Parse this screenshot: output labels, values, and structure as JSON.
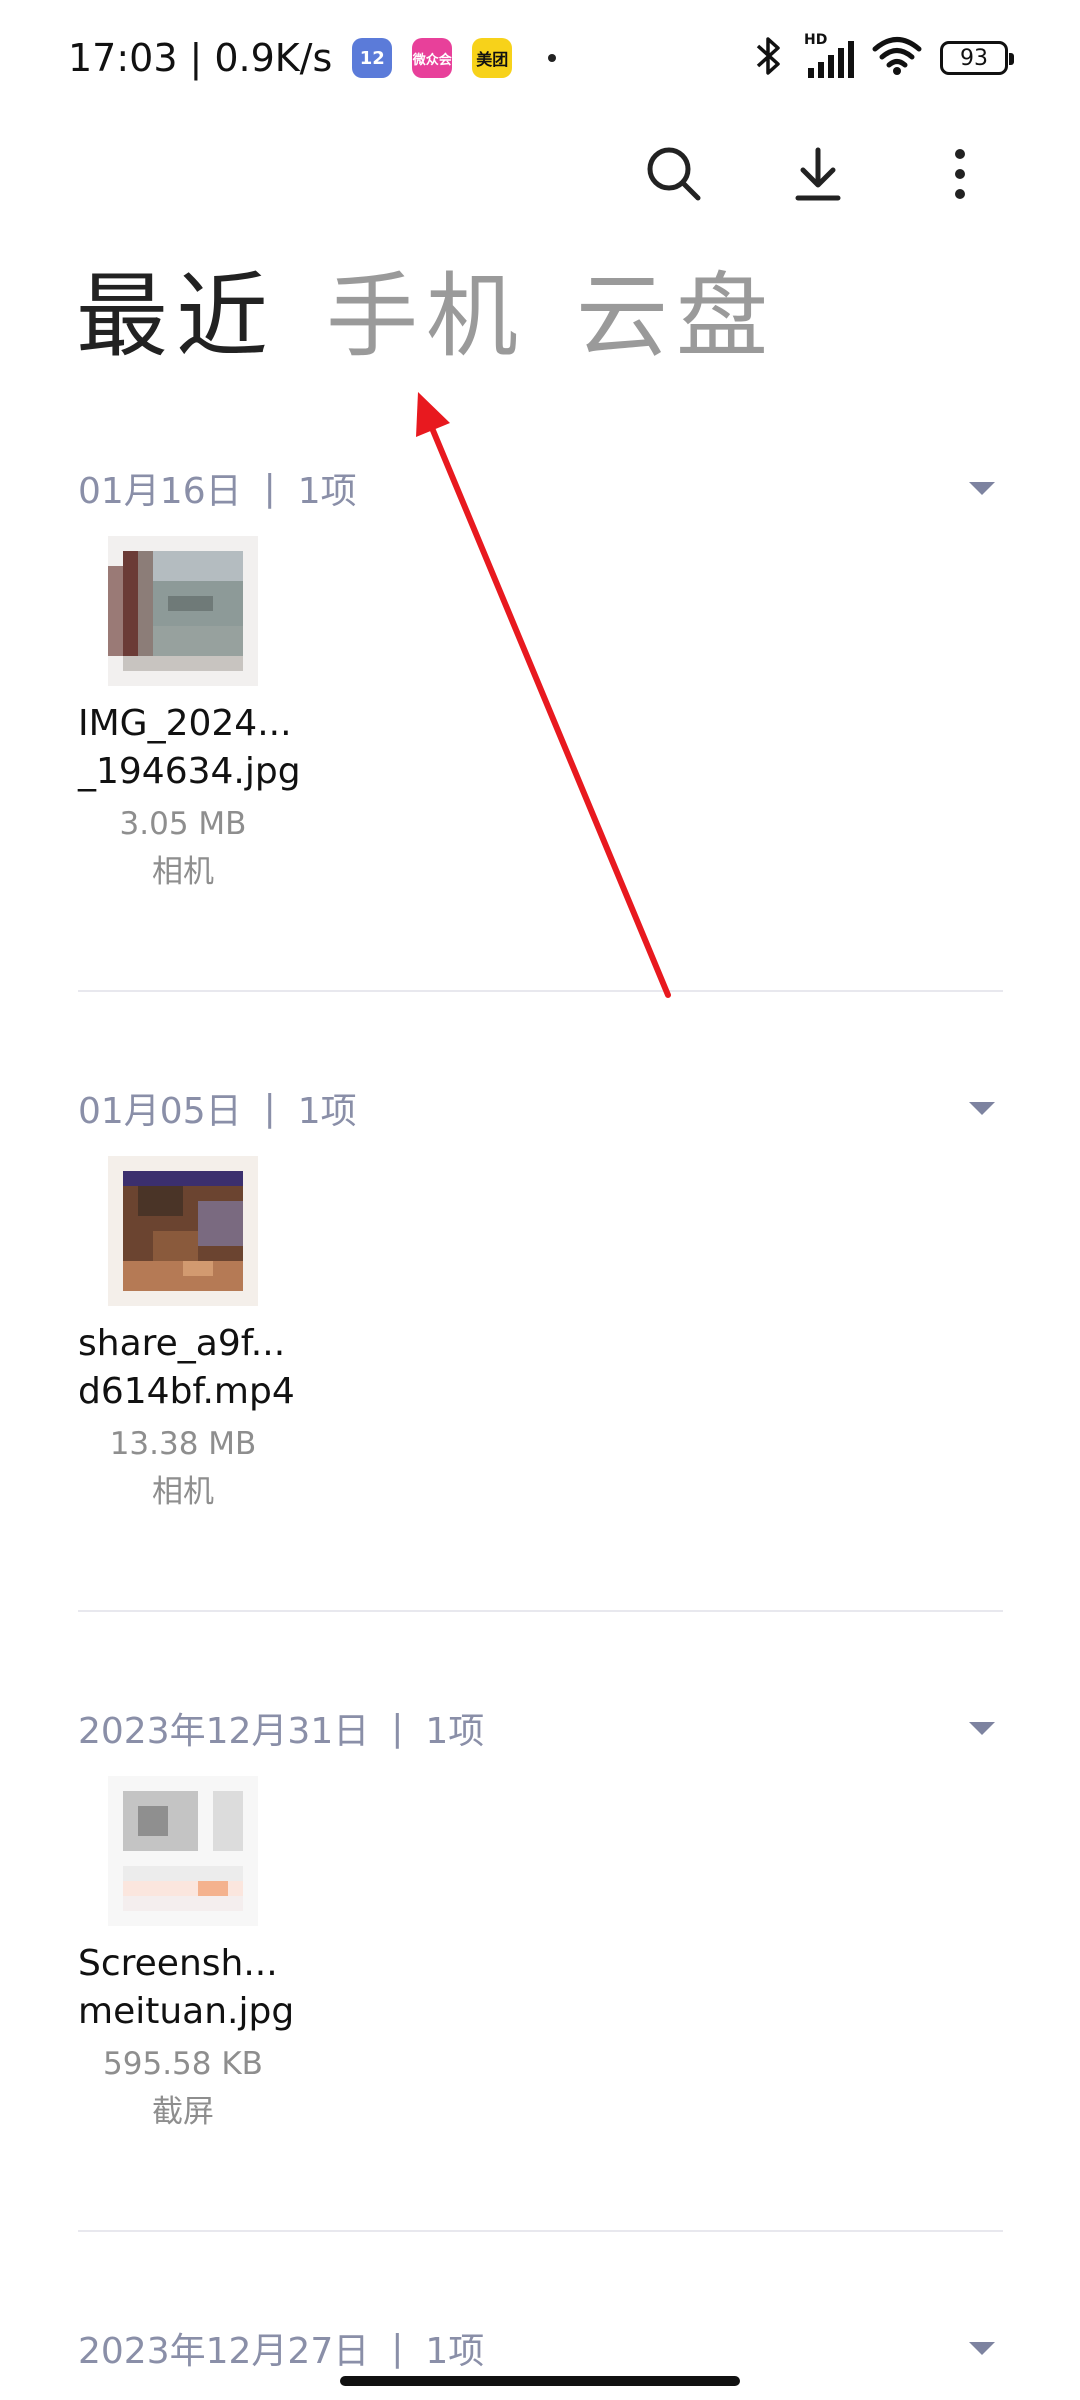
{
  "status_bar": {
    "time": "17:03",
    "net_speed": "0.9K/s",
    "app_badges": [
      {
        "name": "12",
        "color": "#5b7bd9"
      },
      {
        "name": "微众会",
        "color": "#e8409a"
      },
      {
        "name": "美团",
        "color": "#f7d21a"
      }
    ],
    "network_type": "HD",
    "battery_level": "93"
  },
  "toolbar": {
    "icons": [
      "search-icon",
      "download-icon",
      "more-vert-icon"
    ]
  },
  "tabs": [
    {
      "label": "最近",
      "active": true
    },
    {
      "label": "手机",
      "active": false
    },
    {
      "label": "云盘",
      "active": false
    }
  ],
  "sections": [
    {
      "date": "01月16日",
      "separator": "|",
      "count": "1项",
      "files": [
        {
          "name_line1": "IMG_2024...",
          "name_line2": "_194634.jpg",
          "size": "3.05 MB",
          "source": "相机"
        }
      ]
    },
    {
      "date": "01月05日",
      "separator": "|",
      "count": "1项",
      "files": [
        {
          "name_line1": "share_a9f...",
          "name_line2": "d614bf.mp4",
          "size": "13.38 MB",
          "source": "相机"
        }
      ]
    },
    {
      "date": "2023年12月31日",
      "separator": "|",
      "count": "1项",
      "files": [
        {
          "name_line1": "Screensh...",
          "name_line2": "meituan.jpg",
          "size": "595.58 KB",
          "source": "截屏"
        }
      ]
    },
    {
      "date": "2023年12月27日",
      "separator": "|",
      "count": "1项",
      "files": []
    }
  ],
  "colors": {
    "annotation_arrow": "#e8191f",
    "section_header": "#8a8fa8",
    "tab_inactive": "#9a9a9a",
    "tab_active": "#222222"
  }
}
